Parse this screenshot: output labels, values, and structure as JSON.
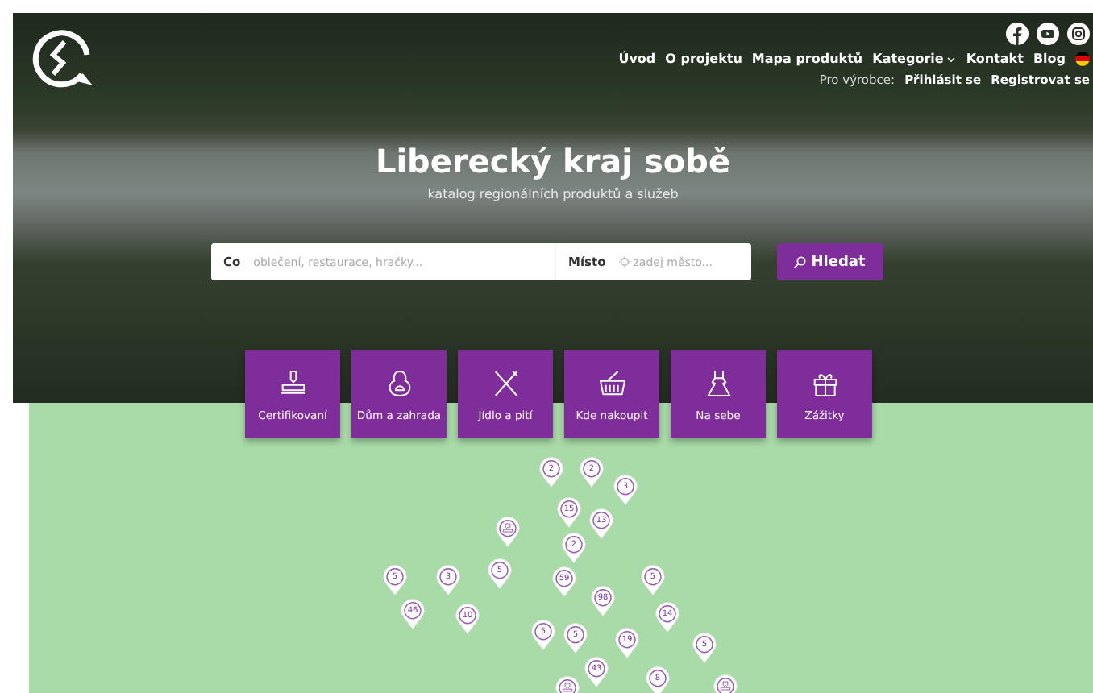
{
  "nav": [
    {
      "label": "Úvod",
      "dropdown": false
    },
    {
      "label": "O projektu",
      "dropdown": false
    },
    {
      "label": "Mapa produktů",
      "dropdown": false
    },
    {
      "label": "Kategorie",
      "dropdown": true
    },
    {
      "label": "Kontakt",
      "dropdown": false
    },
    {
      "label": "Blog",
      "dropdown": false
    }
  ],
  "producer": {
    "label": "Pro výrobce:",
    "links": [
      "Přihlásit se",
      "Registrovat se"
    ]
  },
  "hero": {
    "title": "Liberecký kraj sobě",
    "subtitle": "katalog regionálních produktů a služeb"
  },
  "search": {
    "fields": [
      {
        "label": "Co",
        "placeholder": "oblečení, restaurace, hračky...",
        "kind": "text"
      },
      {
        "label": "Místo",
        "placeholder": "zadej město...",
        "kind": "location"
      }
    ],
    "button": "Hledat"
  },
  "categories": [
    {
      "label": "Certifikovaní",
      "kind": "stamp"
    },
    {
      "label": "Dům a zahrada",
      "kind": "house"
    },
    {
      "label": "Jídlo a pití",
      "kind": "cutlery"
    },
    {
      "label": "Kde nakoupit",
      "kind": "basket"
    },
    {
      "label": "Na sebe",
      "kind": "dress"
    },
    {
      "label": "Zážitky",
      "kind": "gift"
    }
  ],
  "map": {
    "pins": [
      {
        "kind": "count",
        "label": "5"
      },
      {
        "kind": "count",
        "label": "46"
      },
      {
        "kind": "count",
        "label": "3"
      },
      {
        "kind": "count",
        "label": "10"
      },
      {
        "kind": "count",
        "label": "5"
      },
      {
        "kind": "icon"
      },
      {
        "kind": "count",
        "label": "2"
      },
      {
        "kind": "count",
        "label": "2"
      },
      {
        "kind": "count",
        "label": "3"
      },
      {
        "kind": "count",
        "label": "15"
      },
      {
        "kind": "count",
        "label": "13"
      },
      {
        "kind": "count",
        "label": "2"
      },
      {
        "kind": "count",
        "label": "59"
      },
      {
        "kind": "count",
        "label": "98"
      },
      {
        "kind": "count",
        "label": "5"
      },
      {
        "kind": "count",
        "label": "14"
      },
      {
        "kind": "count",
        "label": "5"
      },
      {
        "kind": "count",
        "label": "5"
      },
      {
        "kind": "count",
        "label": "19"
      },
      {
        "kind": "count",
        "label": "43"
      },
      {
        "kind": "count",
        "label": "5"
      },
      {
        "kind": "count",
        "label": "8"
      },
      {
        "kind": "icon"
      },
      {
        "kind": "icon"
      }
    ]
  }
}
